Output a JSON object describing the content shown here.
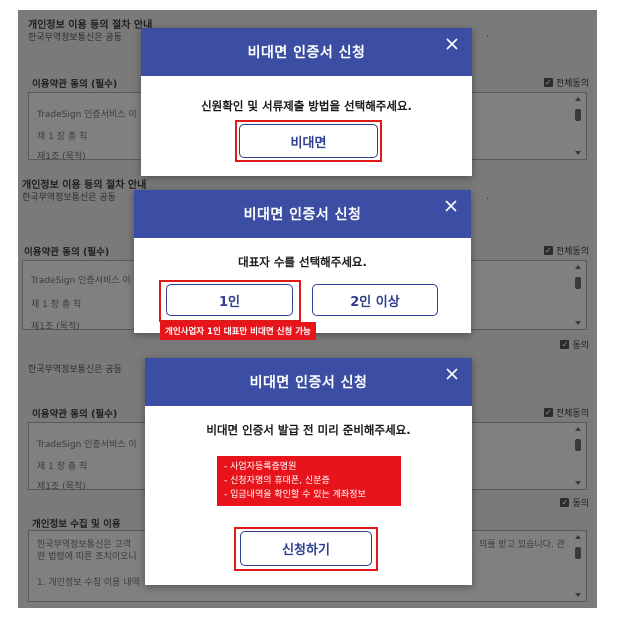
{
  "background": {
    "sections": [
      {
        "title": "개인정보 이용 등의 절차 안내",
        "subtitle": "한국무역정보통신은 공동",
        "subtitle_tail": ".",
        "terms_label": "이용약관 동의 (필수)",
        "select_all": "전체동의",
        "box_lines": [
          "TradeSign 인증서비스 이",
          "제 1 장 총 칙",
          "제1조 (목적)"
        ],
        "agree": "동의"
      },
      {
        "title": "개인정보 이용 등의 절차 안내",
        "subtitle": "한국무역정보통신은 공동",
        "subtitle_tail": ".",
        "terms_label": "이용약관 동의 (필수)",
        "select_all": "전체동의",
        "box_lines": [
          "TradeSign 인증서비스 이",
          "제 1 장 총 칙",
          "제1조 (목적)"
        ],
        "agree": "동의"
      },
      {
        "title": "",
        "subtitle": "한국무역정보통신은 공동",
        "terms_label": "이용약관 동의 (필수)",
        "select_all": "전체동의",
        "box_lines": [
          "TradeSign 인증서비스 이",
          "제 1 장 총 칙",
          "제1조 (목적)"
        ],
        "agree": "동의",
        "collect_title": "개인정보 수집 및 이용",
        "collect_lines": [
          "한국무역정보통신은 고객",
          "련 법령에 따른 조치이오니",
          "1. 개인정보 수집 이용 내역"
        ],
        "collect_tail": "의를 받고 있습니다. 관"
      }
    ]
  },
  "modals": [
    {
      "title": "비대면 인증서 신청",
      "message": "신원확인 및 서류제출 방법을 선택해주세요.",
      "buttons": [
        "비대면"
      ]
    },
    {
      "title": "비대면 인증서 신청",
      "message": "대표자 수를 선택해주세요.",
      "buttons": [
        "1인",
        "2인 이상"
      ],
      "note": "개인사업자 1인 대표만 비대면 신청 가능"
    },
    {
      "title": "비대면 인증서 신청",
      "message": "비대면 인증서 발급 전 미리 준비해주세요.",
      "requirements": [
        "- 사업자등록증명원",
        "- 신청자명의 휴대폰, 신분증",
        "- 입금내역을 확인할 수 있는 계좌정보"
      ],
      "buttons": [
        "신청하기"
      ]
    }
  ],
  "colors": {
    "header_blue": "#3b4ea3",
    "button_border": "#2f3f8f",
    "highlight_red": "#e01818",
    "note_red": "#e8141b"
  },
  "icons": [
    "close-icon",
    "checkbox-icon"
  ]
}
